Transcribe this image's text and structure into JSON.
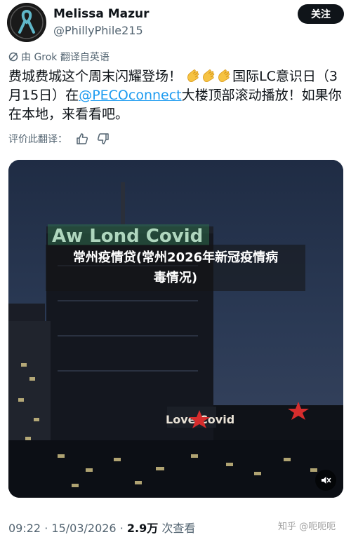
{
  "author": {
    "name": "Melissa Mazur",
    "handle": "@PhillyPhile215",
    "follow_label": "关注"
  },
  "translation": {
    "note": "由 Grok 翻译自英语"
  },
  "tweet": {
    "text_part1": "费城费城这个周末闪耀登场！",
    "text_part2": "国际LC意识日（3月15日）在",
    "mention": "@PECOconnect",
    "text_part3": "大楼顶部滚动播放！如果你在本地，来看看吧。"
  },
  "rate": {
    "label": "评价此翻译："
  },
  "media": {
    "overlay_line1": "常州疫情贷(常州2026年新冠疫情病",
    "overlay_line2": "毒情况)"
  },
  "footer": {
    "time": "09:22",
    "date": "15/03/2026",
    "views_count": "2.9万",
    "views_label": "次查看",
    "watermark": "知乎 @呃呃呃"
  },
  "colors": {
    "accent": "#1d9bf0",
    "text": "#0f1419",
    "muted": "#536471"
  }
}
